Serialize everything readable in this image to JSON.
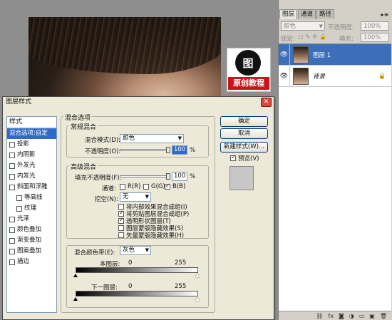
{
  "logo": {
    "glyph": "图",
    "text": "原创教程"
  },
  "layers_panel": {
    "tabs": [
      "图层",
      "通道",
      "路径"
    ],
    "menu_icon": "▸≡",
    "blend_mode": "颜色",
    "opacity_label": "不透明度:",
    "opacity_value": "100%",
    "lock_label": "锁定:",
    "fill_label": "填充:",
    "fill_value": "100%",
    "layers": [
      {
        "name": "图层 1",
        "selected": true
      },
      {
        "name": "背景",
        "selected": false
      }
    ],
    "bottom_icons": [
      "⛓",
      "fx",
      "◙",
      "◑",
      "▭",
      "▣",
      "🗑"
    ]
  },
  "dialog": {
    "title": "图层样式",
    "close": "✕",
    "styles_header": "样式",
    "style_items": [
      {
        "label": "混合选项:自定",
        "checkbox": false,
        "selected": true,
        "indent": 0
      },
      {
        "label": "投影",
        "checkbox": true,
        "selected": false,
        "indent": 0
      },
      {
        "label": "内阴影",
        "checkbox": true,
        "selected": false,
        "indent": 0
      },
      {
        "label": "外发光",
        "checkbox": true,
        "selected": false,
        "indent": 0
      },
      {
        "label": "内发光",
        "checkbox": true,
        "selected": false,
        "indent": 0
      },
      {
        "label": "斜面和浮雕",
        "checkbox": true,
        "selected": false,
        "indent": 0
      },
      {
        "label": "等高线",
        "checkbox": true,
        "selected": false,
        "indent": 1
      },
      {
        "label": "纹理",
        "checkbox": true,
        "selected": false,
        "indent": 1
      },
      {
        "label": "光泽",
        "checkbox": true,
        "selected": false,
        "indent": 0
      },
      {
        "label": "颜色叠加",
        "checkbox": true,
        "selected": false,
        "indent": 0
      },
      {
        "label": "渐变叠加",
        "checkbox": true,
        "selected": false,
        "indent": 0
      },
      {
        "label": "图案叠加",
        "checkbox": true,
        "selected": false,
        "indent": 0
      },
      {
        "label": "描边",
        "checkbox": true,
        "selected": false,
        "indent": 0
      }
    ],
    "blend_options": {
      "title": "混合选项",
      "general_title": "常规混合",
      "blend_mode_label": "混合模式(D):",
      "blend_mode_value": "颜色",
      "opacity_label": "不透明度(O):",
      "opacity_value": "100",
      "percent": "%",
      "advanced_title": "高级混合",
      "fill_opacity_label": "填充不透明度(F):",
      "fill_opacity_value": "100",
      "channels_label": "通道:",
      "channels": [
        {
          "label": "R(R)",
          "checked": false
        },
        {
          "label": "G(G)",
          "checked": false
        },
        {
          "label": "B(B)",
          "checked": true
        }
      ],
      "knockout_label": "挖空(N):",
      "knockout_value": "无",
      "advanced_checks": [
        {
          "label": "将内部效果混合成组(I)",
          "checked": false
        },
        {
          "label": "将剪贴图层混合成组(P)",
          "checked": true
        },
        {
          "label": "透明形状图层(T)",
          "checked": true
        },
        {
          "label": "图层蒙版隐藏效果(S)",
          "checked": false
        },
        {
          "label": "矢量蒙版隐藏效果(H)",
          "checked": false
        }
      ],
      "blend_if_label": "混合颜色带(E):",
      "blend_if_value": "灰色",
      "this_layer_label": "本图层:",
      "this_layer_min": "0",
      "this_layer_max": "255",
      "underlying_label": "下一图层:",
      "underlying_min": "0",
      "underlying_max": "255"
    },
    "buttons": {
      "ok": "确定",
      "cancel": "取消",
      "new_style": "新建样式(W)...",
      "preview": "预览(V)"
    }
  }
}
